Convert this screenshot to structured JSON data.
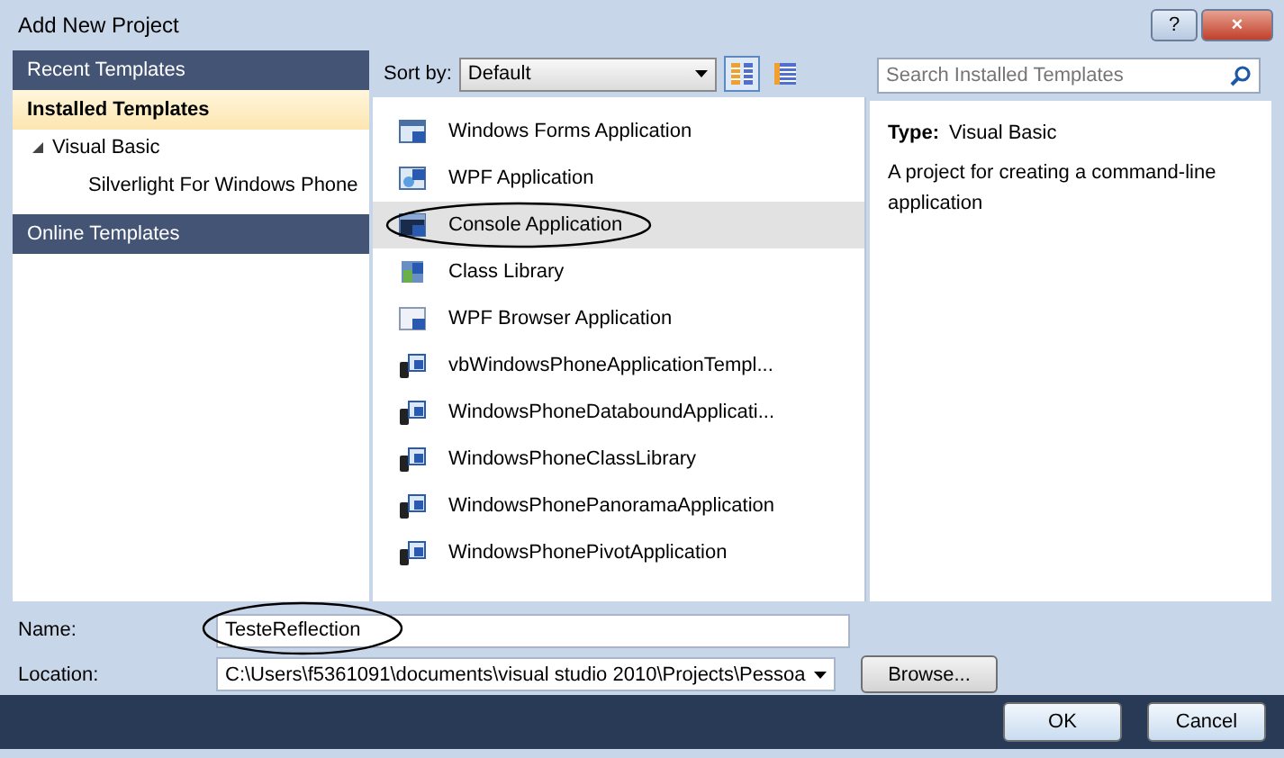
{
  "window": {
    "title": "Add New Project",
    "buttons": [
      "?",
      "×"
    ]
  },
  "sidebar": {
    "sections": [
      {
        "label": "Recent Templates",
        "selected": false
      },
      {
        "label": "Installed Templates",
        "selected": true,
        "children": [
          {
            "label": "Visual Basic",
            "expanded": true,
            "children": [
              {
                "label": "Silverlight For Windows Phone"
              }
            ]
          }
        ]
      },
      {
        "label": "Online Templates",
        "selected": false
      }
    ]
  },
  "toolbar": {
    "sort_label": "Sort by:",
    "sort_value": "Default",
    "views": [
      {
        "kind": "medium",
        "selected": true
      },
      {
        "kind": "small",
        "selected": false
      }
    ]
  },
  "templates": [
    {
      "name": "Windows Forms Application",
      "kind": "form",
      "selected": false,
      "circled": false
    },
    {
      "name": "WPF Application",
      "kind": "wpf",
      "selected": false,
      "circled": false
    },
    {
      "name": "Console Application",
      "kind": "console",
      "selected": true,
      "circled": true
    },
    {
      "name": "Class Library",
      "kind": "library",
      "selected": false,
      "circled": false
    },
    {
      "name": "WPF Browser Application",
      "kind": "browser",
      "selected": false,
      "circled": false
    },
    {
      "name": "vbWindowsPhoneApplicationTempl...",
      "kind": "phone",
      "selected": false,
      "circled": false
    },
    {
      "name": "WindowsPhoneDataboundApplicati...",
      "kind": "phone",
      "selected": false,
      "circled": false
    },
    {
      "name": "WindowsPhoneClassLibrary",
      "kind": "phone",
      "selected": false,
      "circled": false
    },
    {
      "name": "WindowsPhonePanoramaApplication",
      "kind": "phone",
      "selected": false,
      "circled": false
    },
    {
      "name": "WindowsPhonePivotApplication",
      "kind": "phone",
      "selected": false,
      "circled": false
    }
  ],
  "search": {
    "placeholder": "Search Installed Templates"
  },
  "details": {
    "type_label": "Type:",
    "type_value": "Visual Basic",
    "description": "A project for creating a command-line application"
  },
  "form": {
    "name_label": "Name:",
    "name_value": "TesteReflection",
    "name_circled": true,
    "location_label": "Location:",
    "location_value": "C:\\Users\\f5361091\\documents\\visual studio 2010\\Projects\\Pessoa",
    "browse": "Browse..."
  },
  "buttons": [
    "OK",
    "Cancel"
  ]
}
